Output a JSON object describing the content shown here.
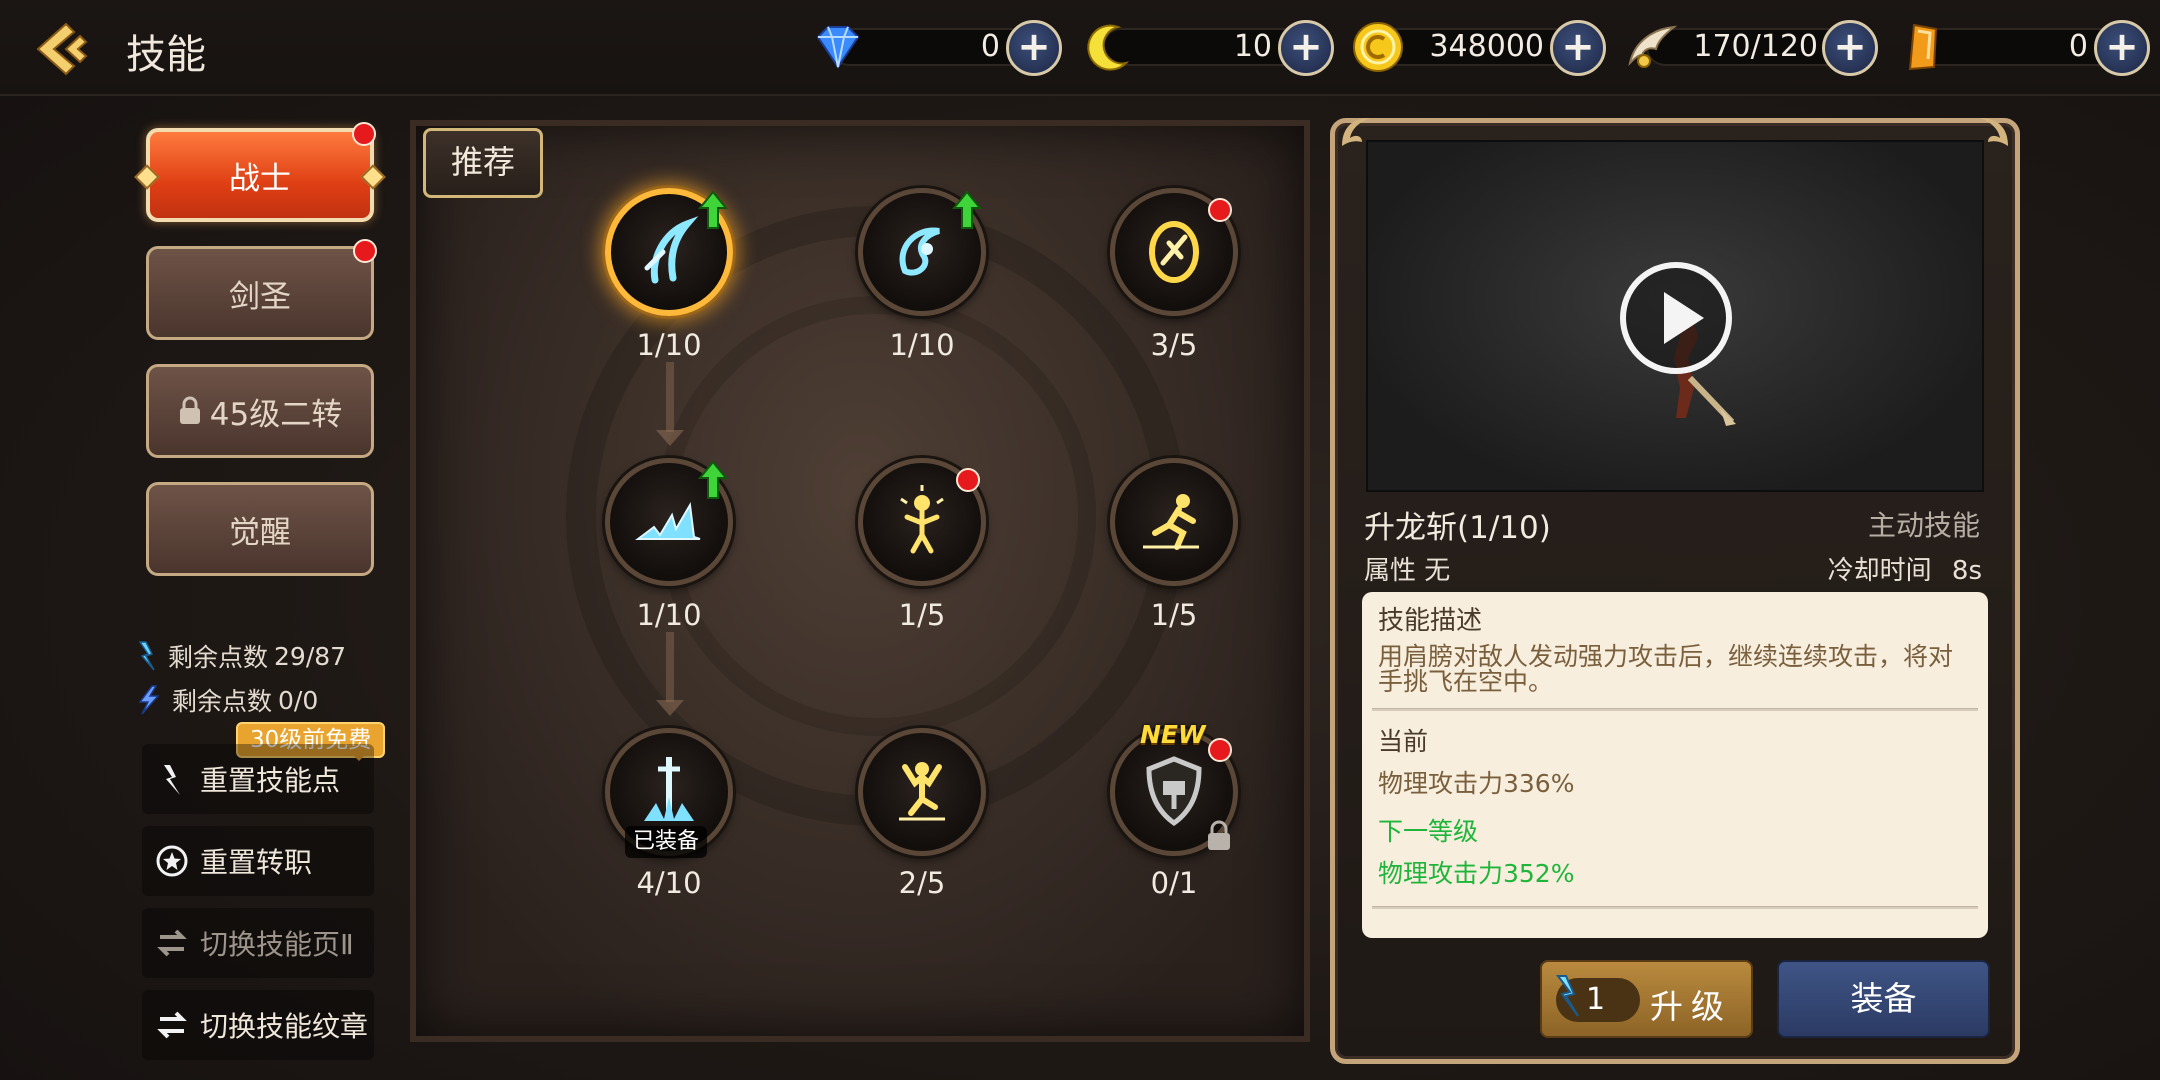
{
  "header": {
    "title": "技能"
  },
  "currencies": [
    {
      "name": "diamond",
      "value": "0",
      "color": "#3a8bff"
    },
    {
      "name": "moon",
      "value": "10",
      "color": "#f5e03a"
    },
    {
      "name": "gold",
      "value": "348000",
      "color": "#f7c81c"
    },
    {
      "name": "wing",
      "value": "170/120",
      "color": "#e9dcc5"
    },
    {
      "name": "crystal",
      "value": "0",
      "color": "#f29a1a"
    }
  ],
  "class_tabs": [
    {
      "label": "战士",
      "active": true,
      "badge": true
    },
    {
      "label": "剑圣",
      "active": false,
      "badge": true
    },
    {
      "label": "45级二转",
      "active": false,
      "locked": true
    },
    {
      "label": "觉醒",
      "active": false
    }
  ],
  "points": [
    {
      "label": "剩余点数",
      "value": "29/87"
    },
    {
      "label": "剩余点数",
      "value": "0/0"
    }
  ],
  "tooltip": "30级前免费",
  "actions": [
    {
      "label": "重置技能点"
    },
    {
      "label": "重置转职"
    },
    {
      "label": "切换技能页Ⅱ",
      "dim": true
    },
    {
      "label": "切换技能纹章"
    }
  ],
  "tree": {
    "recommend_label": "推荐",
    "skills": [
      {
        "level": "1/10",
        "icon": "slash-icon",
        "upgradable": true,
        "selected": true
      },
      {
        "level": "1/10",
        "icon": "whirl-icon",
        "upgradable": true
      },
      {
        "level": "3/5",
        "icon": "spin-icon",
        "badge": true
      },
      {
        "level": "1/10",
        "icon": "wave-icon",
        "upgradable": true
      },
      {
        "level": "1/5",
        "icon": "buff-icon",
        "badge": true
      },
      {
        "level": "1/5",
        "icon": "dash-icon"
      },
      {
        "level": "4/10",
        "icon": "sword-plunge-icon",
        "equipped": "已装备"
      },
      {
        "level": "2/5",
        "icon": "leap-icon"
      },
      {
        "level": "0/1",
        "icon": "shield-icon",
        "new": "NEW",
        "badge": true,
        "locked": true
      }
    ]
  },
  "detail": {
    "name": "升龙斩(1/10)",
    "type": "主动技能",
    "attribute": "属性 无",
    "cooldown_label": "冷却时间",
    "cooldown": "8s",
    "desc_title": "技能描述",
    "desc_text": "用肩膀对敌人发动强力攻击后，继续连续攻击，将对手挑飞在空中。",
    "current_label": "当前",
    "current_value": "物理攻击力336%",
    "next_label": "下一等级",
    "next_value": "物理攻击力352%",
    "upgrade_cost": "1",
    "upgrade_label": "升级",
    "equip_label": "装备"
  }
}
